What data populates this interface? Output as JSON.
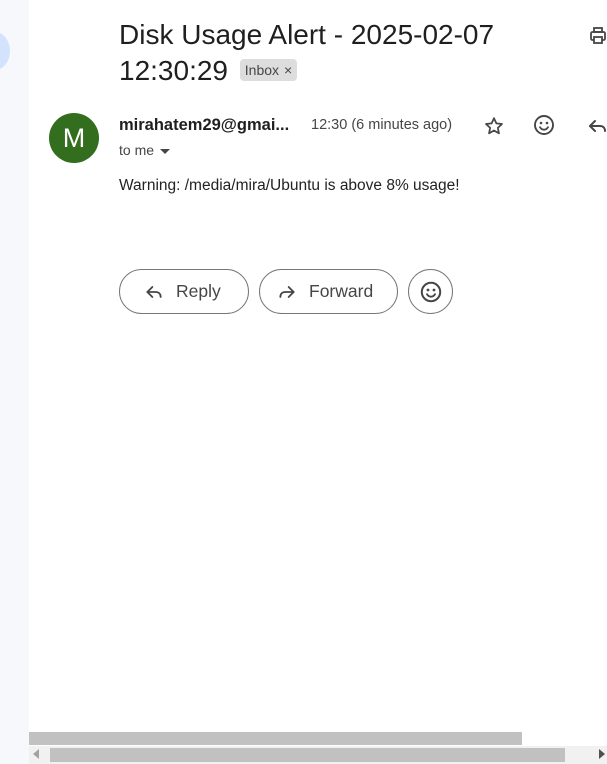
{
  "email": {
    "subject": "Disk Usage Alert - 2025-02-07 12:30:29",
    "label": "Inbox",
    "label_remove": "×",
    "sender_initial": "M",
    "sender": "mirahatem29@gmai...",
    "time": "12:30 (6 minutes ago)",
    "recipient": "to me",
    "body": "Warning: /media/mira/Ubuntu is above 8% usage!"
  },
  "actions": {
    "reply_label": "Reply",
    "forward_label": "Forward"
  },
  "icons": {
    "star": "star-icon",
    "emoji": "emoji-icon",
    "reply": "reply-icon",
    "forward": "forward-icon",
    "print": "print-icon"
  },
  "colors": {
    "avatar": "#336d1e",
    "label_chip_bg": "#dddddd",
    "sidebar_bg": "#f6f8fc"
  }
}
